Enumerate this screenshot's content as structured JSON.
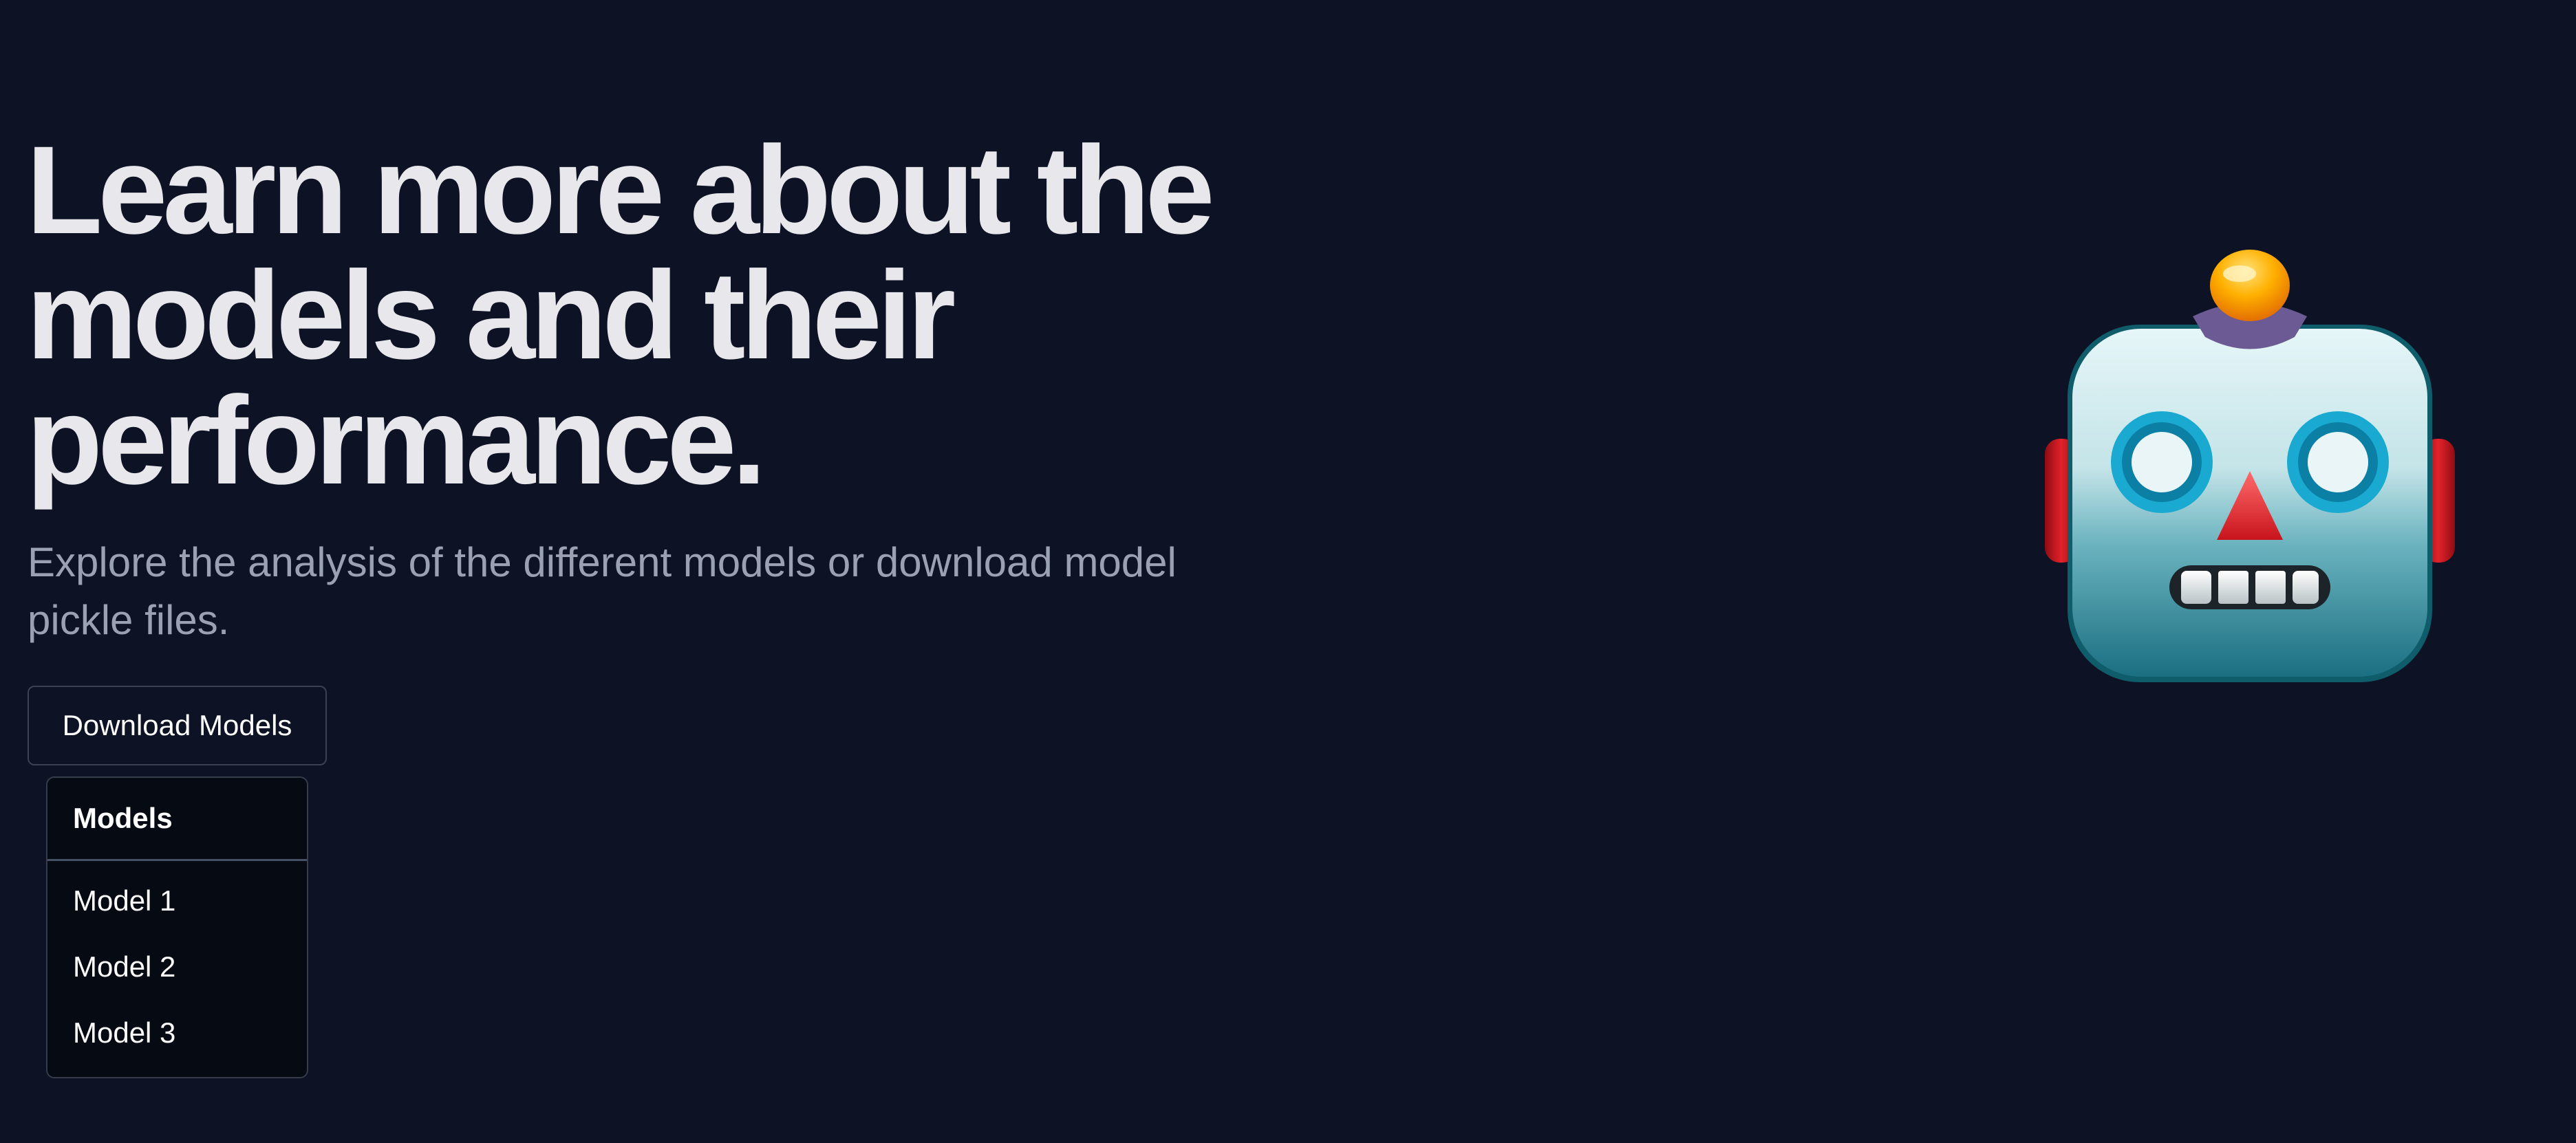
{
  "hero": {
    "title": "Learn more about the models and their performance.",
    "subtitle": "Explore the analysis of the different models or download model pickle files."
  },
  "download": {
    "button_label": "Download Models"
  },
  "dropdown": {
    "header": "Models",
    "items": [
      "Model 1",
      "Model 2",
      "Model 3"
    ]
  },
  "illustration": {
    "icon": "robot-face-icon"
  },
  "colors": {
    "background": "#0d1325",
    "title": "#e7e7ec",
    "subtitle": "#9aa1b2",
    "dropdown_background": "#060a13"
  }
}
